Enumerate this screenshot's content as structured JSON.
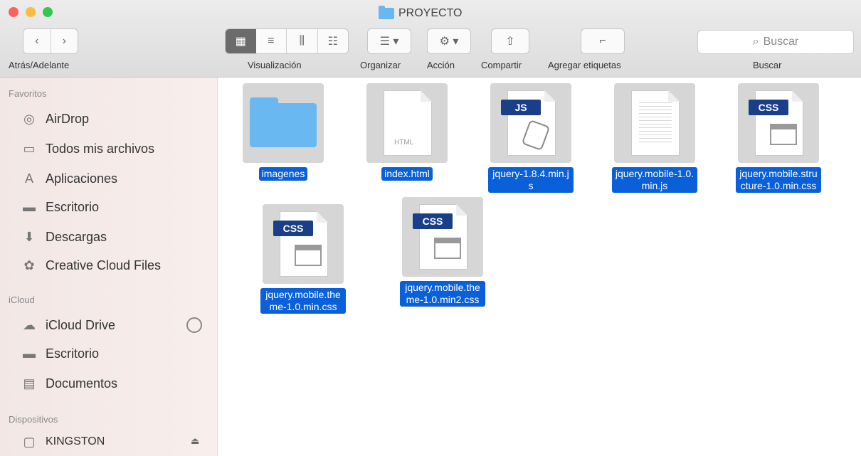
{
  "window": {
    "title": "PROYECTO"
  },
  "toolbar": {
    "nav_label": "Atrás/Adelante",
    "back": "‹",
    "forward": "›",
    "view_label": "Visualización",
    "organize_label": "Organizar",
    "action_label": "Acción",
    "share_label": "Compartir",
    "tags_label": "Agregar etiquetas",
    "search_label": "Buscar",
    "search_placeholder": "Buscar"
  },
  "sidebar": {
    "favorites_title": "Favoritos",
    "favorites": [
      {
        "label": "AirDrop",
        "icon": "airdrop-icon"
      },
      {
        "label": "Todos mis archivos",
        "icon": "all-files-icon"
      },
      {
        "label": "Aplicaciones",
        "icon": "applications-icon"
      },
      {
        "label": "Escritorio",
        "icon": "desktop-icon"
      },
      {
        "label": "Descargas",
        "icon": "downloads-icon"
      },
      {
        "label": "Creative Cloud Files",
        "icon": "creative-cloud-icon"
      }
    ],
    "icloud_title": "iCloud",
    "icloud": [
      {
        "label": "iCloud Drive",
        "icon": "icloud-icon"
      },
      {
        "label": "Escritorio",
        "icon": "desktop-icon"
      },
      {
        "label": "Documentos",
        "icon": "documents-icon"
      }
    ],
    "devices_title": "Dispositivos",
    "devices": [
      {
        "label": "KINGSTON",
        "icon": "drive-icon"
      }
    ]
  },
  "files": [
    {
      "name": "imagenes",
      "kind": "folder"
    },
    {
      "name": "index.html",
      "kind": "html"
    },
    {
      "name": "jquery-1.8.4.min.js",
      "kind": "js",
      "badge": "JS"
    },
    {
      "name": "jquery.mobile-1.0.min.js",
      "kind": "doc"
    },
    {
      "name": "jquery.mobile.structure-1.0.min.css",
      "kind": "css",
      "badge": "CSS"
    },
    {
      "name": "jquery.mobile.theme-1.0.min.css",
      "kind": "css",
      "badge": "CSS"
    },
    {
      "name": "jquery.mobile.theme-1.0.min2.css",
      "kind": "css",
      "badge": "CSS"
    }
  ],
  "index_thumb_label": "HTML"
}
